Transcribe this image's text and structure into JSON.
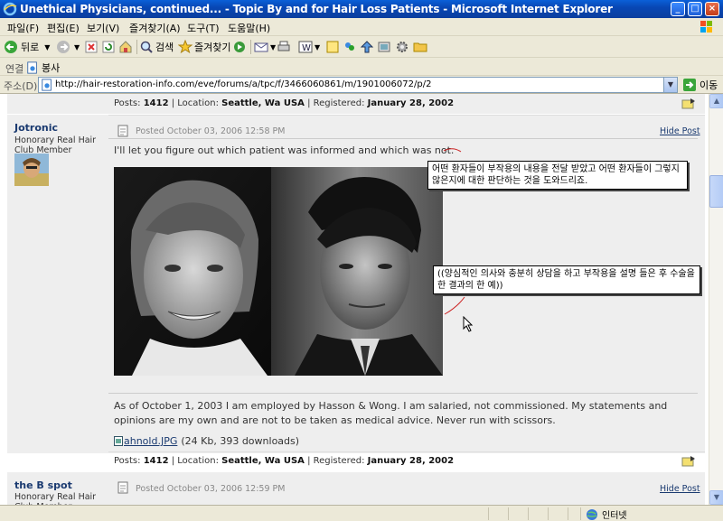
{
  "window": {
    "title": "Unethical Physicians, continued... - Topic By and for Hair Loss Patients - Microsoft Internet Explorer"
  },
  "menu": {
    "items": [
      "파일(F)",
      "편집(E)",
      "보기(V)",
      "즐겨찾기(A)",
      "도구(T)",
      "도움말(H)"
    ]
  },
  "toolbar": {
    "back_label": "뒤로",
    "search_label": "검색",
    "favorites_label": "즐겨찾기"
  },
  "links": {
    "label": "연결",
    "item": "봉사"
  },
  "address": {
    "label": "주소(D)",
    "url": "http://hair-restoration-info.com/eve/forums/a/tpc/f/3466060861/m/1901006072/p/2",
    "go_label": "이동"
  },
  "post_prev_meta": {
    "posts_label": "Posts:",
    "posts_value": "1412",
    "location_label": "Location:",
    "location_value": "Seattle, Wa USA",
    "registered_label": "Registered:",
    "registered_value": "January 28, 2002"
  },
  "post1": {
    "username": "Jotronic",
    "user_title": "Honorary Real Hair Club Member",
    "posted": "Posted October 03, 2006 12:58 PM",
    "hide_label": "Hide Post",
    "text": "I'll let you figure out which patient was informed and which was not.",
    "annotation1": "어떤 환자들이 부작용의 내용을 전달 받았고 어떤 환자들이 그렇지 않은지에 대한 판단하는 것을 도와드리죠.",
    "annotation2": "((양심적인 의사와 충분히 상담을 하고 부작용을 설명 들은 후 수술을 한 결과의 한 예))",
    "signature": "As of October 1, 2003 I am employed by Hasson & Wong. I am salaried, not commissioned. My statements and opinions are my own and are not to be taken as medical advice. Never run with scissors.",
    "attachment_name": "ahnold.JPG",
    "attachment_info": "(24 Kb, 393 downloads)",
    "meta": {
      "posts_label": "Posts:",
      "posts_value": "1412",
      "location_label": "Location:",
      "location_value": "Seattle, Wa USA",
      "registered_label": "Registered:",
      "registered_value": "January 28, 2002"
    }
  },
  "post2": {
    "username": "the B spot",
    "user_title": "Honorary Real Hair Club Member",
    "posted": "Posted October 03, 2006 12:59 PM",
    "hide_label": "Hide Post"
  },
  "status": {
    "zone": "인터넷"
  }
}
